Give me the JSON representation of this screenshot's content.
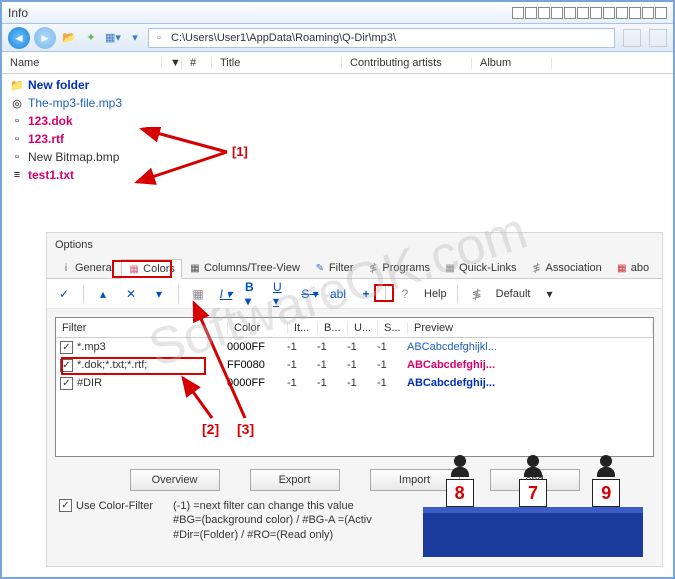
{
  "window": {
    "title": "Info"
  },
  "address_bar": {
    "path": "C:\\Users\\User1\\AppData\\Roaming\\Q-Dir\\mp3\\"
  },
  "columns": {
    "name": "Name",
    "num": "#",
    "title": "Title",
    "contrib": "Contributing artists",
    "album": "Album"
  },
  "files": [
    {
      "name": "New folder",
      "cls": "bold-blue",
      "icon": "📁"
    },
    {
      "name": "The-mp3-file.mp3",
      "cls": "blue",
      "icon": "◎"
    },
    {
      "name": "123.dok",
      "cls": "bold-pink",
      "icon": "▫"
    },
    {
      "name": "123.rtf",
      "cls": "bold-pink",
      "icon": "▫"
    },
    {
      "name": "New Bitmap.bmp",
      "cls": "normal",
      "icon": "▫"
    },
    {
      "name": "test1.txt",
      "cls": "bold-pink",
      "icon": "≡"
    }
  ],
  "options": {
    "title": "Options"
  },
  "tabs": {
    "general": "General",
    "colors": "Colors",
    "columns": "Columns/Tree-View",
    "filter": "Filter",
    "programs": "Programs",
    "quicklinks": "Quick-Links",
    "association": "Association",
    "about": "abo"
  },
  "toolbar2": {
    "help": "Help",
    "default": "Default"
  },
  "filter_columns": {
    "filter": "Filter",
    "color": "Color",
    "it": "It...",
    "b": "B...",
    "u": "U...",
    "s": "S...",
    "preview": "Preview"
  },
  "filters": [
    {
      "name": "*.mp3",
      "color": "0000FF",
      "it": "-1",
      "b": "-1",
      "u": "-1",
      "s": "-1",
      "preview": "ABCabcdefghijkl...",
      "pcls": "blue"
    },
    {
      "name": "*.dok;*.txt;*.rtf;",
      "color": "FF0080",
      "it": "-1",
      "b": "-1",
      "u": "-1",
      "s": "-1",
      "preview": "ABCabcdefghij...",
      "pcls": "bold-pink"
    },
    {
      "name": "#DIR",
      "color": "0000FF",
      "it": "-1",
      "b": "-1",
      "u": "-1",
      "s": "-1",
      "preview": "ABCabcdefghij...",
      "pcls": "bold-blue"
    }
  ],
  "buttons": {
    "overview": "Overview",
    "export": "Export",
    "import": "Import",
    "extend": "end"
  },
  "footer": {
    "use_color_filter": "Use Color-Filter",
    "legend1": "(-1) =next filter can change this value",
    "legend2": "#BG=(background color) / #BG-A =(Activ",
    "legend3": "#Dir=(Folder) / #RO=(Read only)"
  },
  "annotations": {
    "a1": "[1]",
    "a2": "[2]",
    "a3": "[3]"
  },
  "judges": [
    "8",
    "7",
    "9"
  ],
  "watermark": "SoftwareOK.com"
}
